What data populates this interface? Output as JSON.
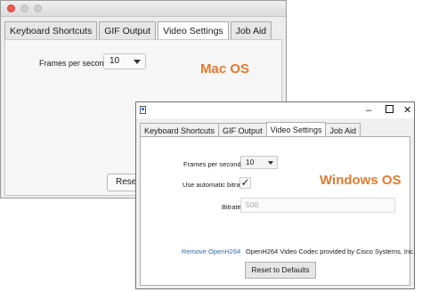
{
  "mac_window": {
    "tabs": [
      "Keyboard Shortcuts",
      "GIF Output",
      "Video Settings",
      "Job Aid"
    ],
    "active_tab": "Video Settings",
    "fps_label": "Frames per second",
    "fps_value": "10",
    "os_label": "Mac OS",
    "reset_button": "Reset to Defaults"
  },
  "windows_window": {
    "tabs": [
      "Keyboard Shortcuts",
      "GIF Output",
      "Video Settings",
      "Job Aid"
    ],
    "active_tab": "Video Settings",
    "fps_label": "Frames per second",
    "fps_value": "10",
    "auto_bitrate_label": "Use automatic bitrate",
    "auto_bitrate_checked": true,
    "bitrate_label": "Bitrate (kb/s)",
    "bitrate_value": "500",
    "os_label": "Windows OS",
    "remove_link": "Remove OpenH264",
    "codec_text": "OpenH264 Video Codec provided by Cisco Systems, Inc.",
    "reset_button": "Reset to Defaults",
    "title_controls": [
      "–",
      "□",
      "✕"
    ]
  },
  "colors": {
    "os_label": "#e47a2e",
    "link": "#2b6bb8",
    "mac_close": "#ee5b53"
  },
  "icons": {
    "mac_traffic_lights": [
      "close-dot",
      "minimize-dot",
      "zoom-dot"
    ],
    "windows_app_icon": "app-icon",
    "checkmark": "check-icon",
    "dropdown": "chevron-down-icon"
  }
}
